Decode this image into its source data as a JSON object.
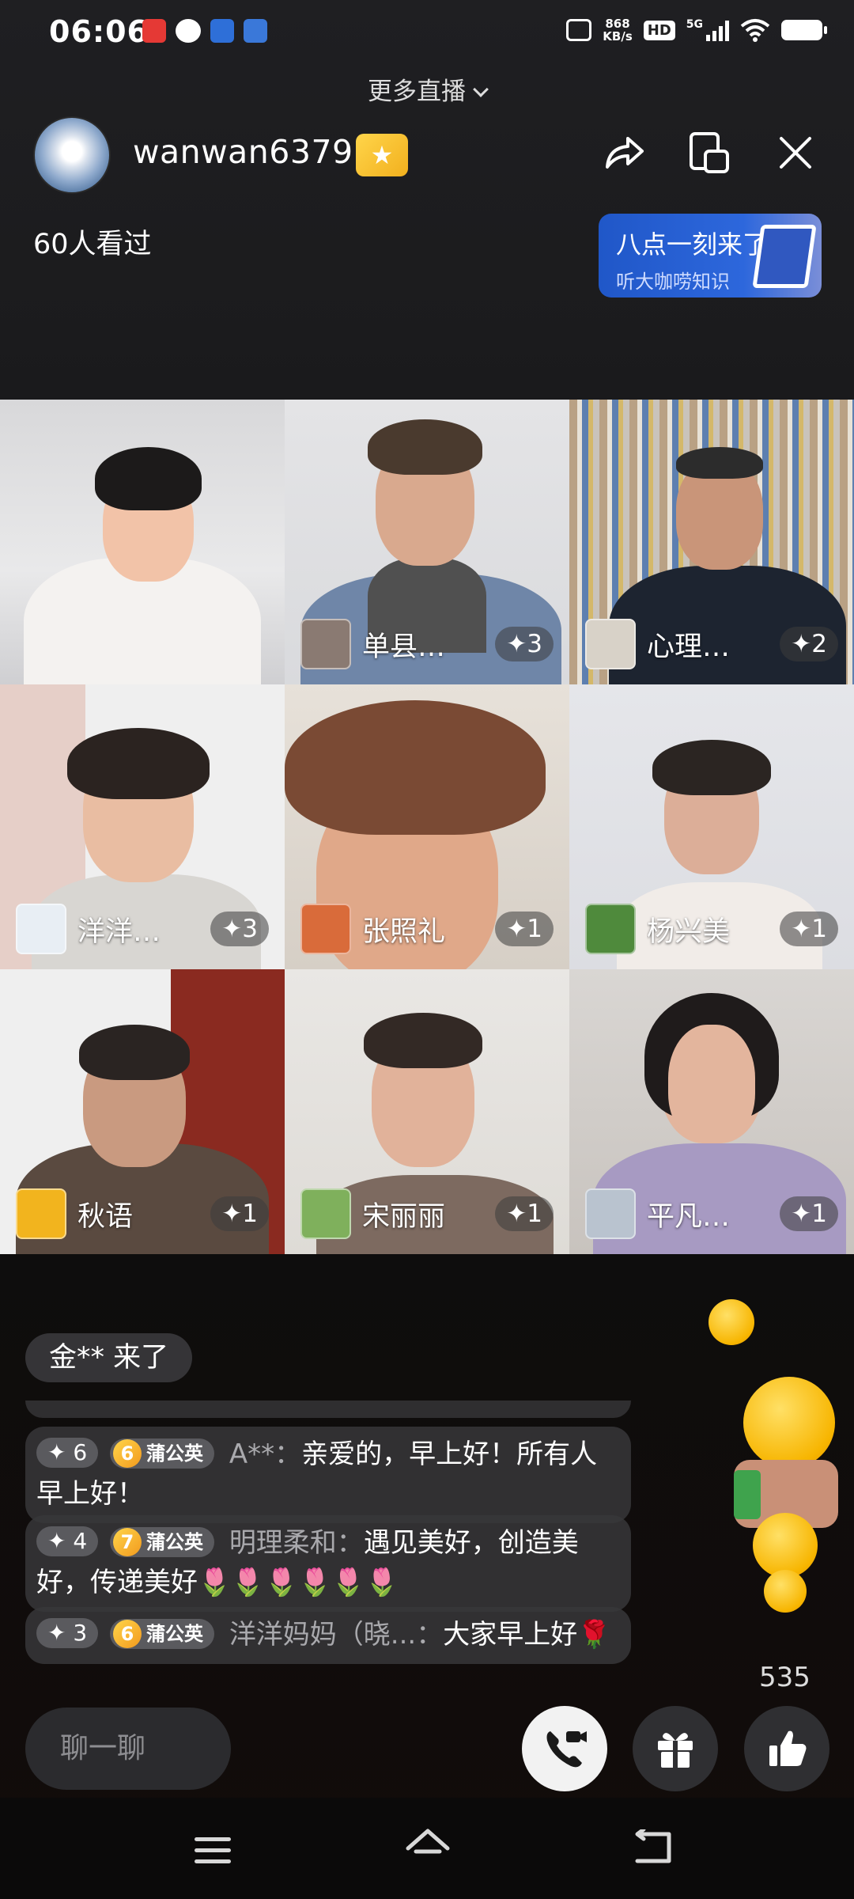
{
  "status_bar": {
    "time": "06:06",
    "net_speed_value": "868",
    "net_speed_unit": "KB/s",
    "hd_label": "HD",
    "network_label": "5G"
  },
  "header": {
    "more_live_label": "更多直播",
    "username": "wanwan6379",
    "viewers_text": "60人看过",
    "promo_title": "八点一刻来了",
    "promo_subtitle": "听大咖唠知识"
  },
  "grid": {
    "tiles": [
      {
        "name": "",
        "count": ""
      },
      {
        "name": "单县…",
        "count": "✦3"
      },
      {
        "name": "心理…",
        "count": "✦2"
      },
      {
        "name": "洋洋…",
        "count": "✦3"
      },
      {
        "name": "张照礼",
        "count": "✦1"
      },
      {
        "name": "杨兴美",
        "count": "✦1"
      },
      {
        "name": "秋语",
        "count": "✦1"
      },
      {
        "name": "宋丽丽",
        "count": "✦1"
      },
      {
        "name": "平凡…",
        "count": "✦1"
      }
    ]
  },
  "chat": {
    "join_notice": "金** 来了",
    "messages": [
      {
        "level": "✦ 6",
        "fan_level": "6",
        "fan_label": "蒲公英",
        "sender": "A**：",
        "text": "亲爱的，早上好！所有人早上好！",
        "emoji": ""
      },
      {
        "level": "✦ 4",
        "fan_level": "7",
        "fan_label": "蒲公英",
        "sender": "明理柔和：",
        "text": "遇见美好，创造美好，传递美好",
        "emoji": "🌷🌷🌷🌷🌷🌷"
      },
      {
        "level": "✦ 3",
        "fan_level": "6",
        "fan_label": "蒲公英",
        "sender": "洋洋妈妈（晓...：",
        "text": "大家早上好",
        "emoji": "🌹"
      }
    ]
  },
  "reactions": {
    "like_count": "535"
  },
  "bottom_bar": {
    "chat_placeholder": "聊一聊"
  },
  "colors": {
    "background": "#121214",
    "promo_blue": "#2d67dc",
    "badge_gold": "#f2b01e",
    "chat_bubble": "#37373a"
  }
}
